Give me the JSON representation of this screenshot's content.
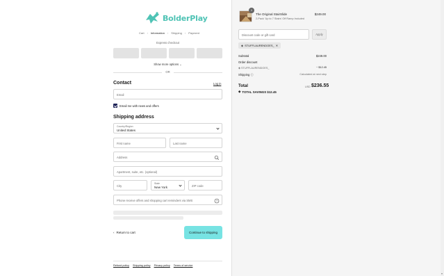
{
  "brand": {
    "name": "BolderPlay",
    "color": "#4fc3b5"
  },
  "breadcrumbs": [
    {
      "label": "Cart",
      "current": false
    },
    {
      "label": "Information",
      "current": true
    },
    {
      "label": "Shipping",
      "current": false
    },
    {
      "label": "Payment",
      "current": false
    }
  ],
  "express": {
    "label": "Express checkout",
    "show_more": "Show more options ⌄",
    "or": "OR"
  },
  "contact": {
    "heading": "Contact",
    "login": "Log in",
    "email_placeholder": "Email",
    "news_checkbox": "Email me with news and offers",
    "news_checked": true
  },
  "shipping": {
    "heading": "Shipping address",
    "country_label": "Country/Region",
    "country_value": "United States",
    "first_name": "First name",
    "last_name": "Last name",
    "address": "Address",
    "apartment": "Apartment, suite, etc. (optional)",
    "city": "City",
    "state_label": "State",
    "state_value": "New York",
    "zip": "ZIP code",
    "phone": "Phone receive offers and shopping cart reminders via SMS"
  },
  "actions": {
    "return": "Return to cart",
    "continue": "Continue to shipping",
    "continue_color": "#77e3e3"
  },
  "footer": [
    "Refund policy",
    "Shipping policy",
    "Privacy policy",
    "Terms of service"
  ],
  "summary": {
    "product": {
      "qty": "1",
      "name": "The Original StairSlide",
      "variant": "2-Pack 'Up to 7 Stairs' Off Ramp Included",
      "price": "$249.00"
    },
    "discount_placeholder": "Discount code or gift card",
    "apply": "Apply",
    "applied_code": "STUFFLAURENDOES_",
    "subtotal_label": "Subtotal",
    "subtotal": "$249.00",
    "order_discount_label": "Order discount",
    "discount_code": "STUFFLAURENDOES_",
    "discount_amount": "− $12.45",
    "shipping_label": "Shipping",
    "shipping_value": "Calculated at next step",
    "total_label": "Total",
    "currency": "USD",
    "total": "$236.55",
    "savings": "TOTAL SAVINGS  $12.45"
  }
}
